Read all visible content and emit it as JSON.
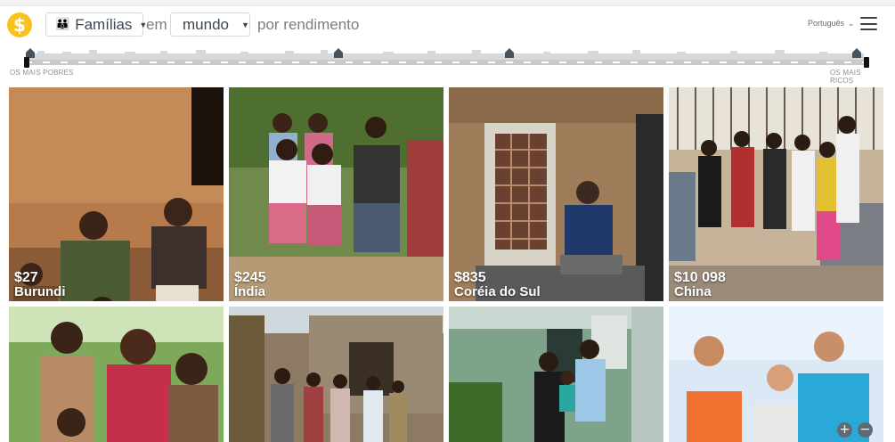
{
  "header": {
    "logo_icon": "dollar-street-logo",
    "things_selector": {
      "icon": "family-icon",
      "label": "Famílias"
    },
    "word_in": "em",
    "place_selector": {
      "label": "mundo"
    },
    "word_by": "por rendimento",
    "language": "Português",
    "menu_icon": "hamburger-menu-icon"
  },
  "income_bar": {
    "left_label": "OS MAIS POBRES",
    "right_label": "OS MAIS RICOS",
    "range_start": 0,
    "range_end": 1
  },
  "tiles": [
    {
      "income": "$27",
      "country": "Burundi"
    },
    {
      "income": "$245",
      "country": "Índia"
    },
    {
      "income": "$835",
      "country": "Coréia do Sul"
    },
    {
      "income": "$10 098",
      "country": "China"
    },
    {
      "income": "",
      "country": ""
    },
    {
      "income": "",
      "country": ""
    },
    {
      "income": "",
      "country": ""
    },
    {
      "income": "",
      "country": ""
    }
  ],
  "zoom": {
    "in_symbol": "+",
    "out_symbol": "−"
  },
  "colors": {
    "accent": "#f7c21b",
    "text": "#3b4650",
    "bar": "#c8cacc"
  }
}
